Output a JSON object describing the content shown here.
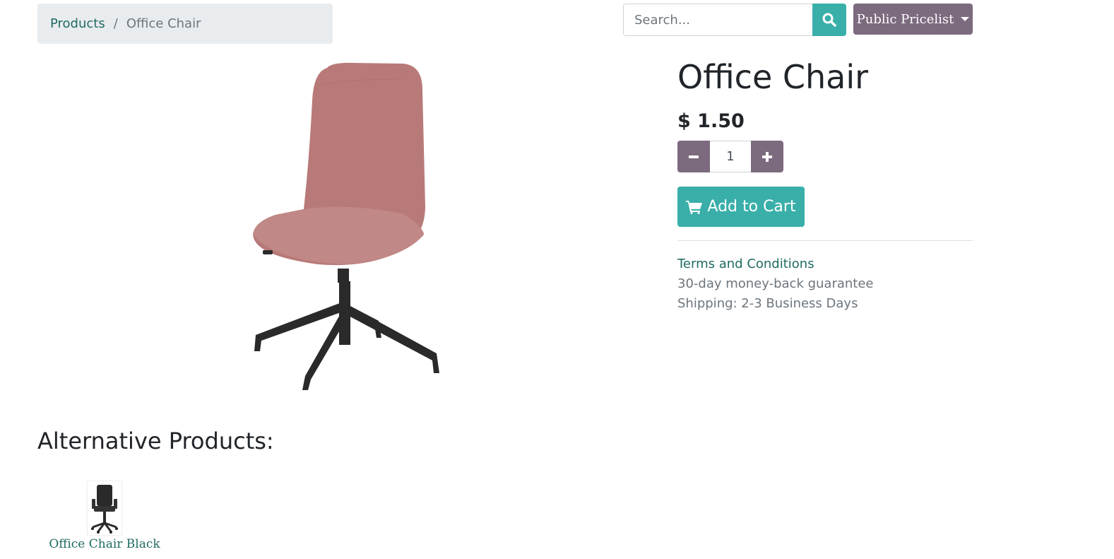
{
  "breadcrumb": {
    "items": [
      {
        "label": "Products"
      },
      {
        "label": "Office Chair"
      }
    ],
    "separator": "/"
  },
  "search": {
    "placeholder": "Search...",
    "value": ""
  },
  "pricelist": {
    "label": "Public Pricelist"
  },
  "product": {
    "name": "Office Chair",
    "price": "$ 1.50",
    "quantity": "1",
    "add_to_cart_label": "Add to Cart",
    "image_icon": "office-chair-pink-image"
  },
  "info": {
    "terms_label": "Terms and Conditions",
    "guarantee": "30-day money-back guarantee",
    "shipping": "Shipping: 2-3 Business Days"
  },
  "alternatives": {
    "heading": "Alternative Products:",
    "items": [
      {
        "label": "Office Chair Black",
        "icon": "office-chair-black-image"
      }
    ]
  },
  "colors": {
    "primary": "#3aafa9",
    "secondary": "#7c6a7e",
    "link": "#1f6b62",
    "chair_fabric": "#b87a78",
    "chair_base": "#2a2a2a"
  }
}
